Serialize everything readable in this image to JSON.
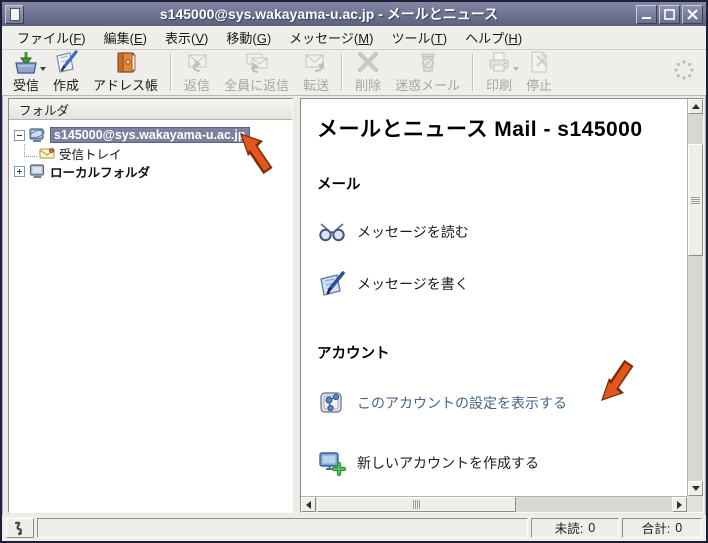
{
  "window": {
    "title": "s145000@sys.wakayama-u.ac.jp - メールとニュース"
  },
  "menubar": {
    "items": [
      {
        "pre": "ファイル(",
        "mn": "F",
        "post": ")"
      },
      {
        "pre": "編集(",
        "mn": "E",
        "post": ")"
      },
      {
        "pre": "表示(",
        "mn": "V",
        "post": ")"
      },
      {
        "pre": "移動(",
        "mn": "G",
        "post": ")"
      },
      {
        "pre": "メッセージ(",
        "mn": "M",
        "post": ")"
      },
      {
        "pre": "ツール(",
        "mn": "T",
        "post": ")"
      },
      {
        "pre": "ヘルプ(",
        "mn": "H",
        "post": ")"
      }
    ]
  },
  "toolbar": {
    "buttons": [
      {
        "label": "受信",
        "enabled": true,
        "has_dropdown": true,
        "icon": "get-mail-icon"
      },
      {
        "label": "作成",
        "enabled": true,
        "has_dropdown": false,
        "icon": "compose-icon"
      },
      {
        "label": "アドレス帳",
        "enabled": true,
        "has_dropdown": false,
        "icon": "address-book-icon"
      },
      {
        "label": "返信",
        "enabled": false,
        "has_dropdown": false,
        "icon": "reply-icon"
      },
      {
        "label": "全員に返信",
        "enabled": false,
        "has_dropdown": false,
        "icon": "reply-all-icon"
      },
      {
        "label": "転送",
        "enabled": false,
        "has_dropdown": false,
        "icon": "forward-icon"
      },
      {
        "label": "削除",
        "enabled": false,
        "has_dropdown": false,
        "icon": "delete-icon"
      },
      {
        "label": "迷惑メール",
        "enabled": false,
        "has_dropdown": false,
        "icon": "junk-icon"
      },
      {
        "label": "印刷",
        "enabled": false,
        "has_dropdown": true,
        "icon": "print-icon"
      },
      {
        "label": "停止",
        "enabled": false,
        "has_dropdown": false,
        "icon": "stop-icon"
      }
    ]
  },
  "folder_pane": {
    "header": "フォルダ",
    "account": {
      "label": "s145000@sys.wakayama-u.ac.jp",
      "selected": true,
      "expanded": true
    },
    "inbox": {
      "label": "受信トレイ"
    },
    "local": {
      "label": "ローカルフォルダ",
      "expanded": false
    }
  },
  "content": {
    "title": "メールとニュース Mail - s145000",
    "mail": {
      "heading": "メール",
      "read_link": "メッセージを読む",
      "write_link": "メッセージを書く"
    },
    "accounts": {
      "heading": "アカウント",
      "settings_link": "このアカウントの設定を表示する",
      "create_link": "新しいアカウントを作成する"
    }
  },
  "statusbar": {
    "unread": {
      "label": "未読:",
      "value": "0"
    },
    "total": {
      "label": "合計:",
      "value": "0"
    }
  },
  "icons": {
    "get_mail": "inbox-tray-with-green-down-arrow",
    "compose": "note-with-blue-pen",
    "address_book": "orange-book",
    "reply": "envelope-back-arrow",
    "reply_all": "two-envelopes-back-arrow",
    "forward": "envelope-forward-arrow",
    "delete": "gray-x",
    "junk": "trash-can-no-symbol",
    "print": "printer",
    "stop": "page-with-x",
    "read_messages": "glasses",
    "write_message": "note-with-pen",
    "account_settings": "settings-panel-with-nodes",
    "new_account": "monitor-with-green-plus",
    "online_status": "squiggle-plug"
  },
  "colors": {
    "titlebar": "#6c7090",
    "selection": "#7d81a0",
    "link_blue": "#44658b",
    "annotation_arrow": "#dd5a1d",
    "toolbar_bg": "#efeeea"
  }
}
